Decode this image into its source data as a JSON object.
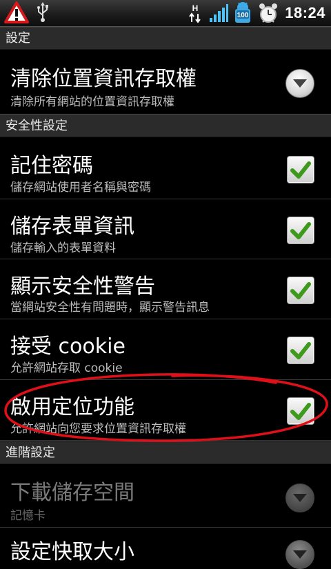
{
  "status_bar": {
    "time": "18:24",
    "network_label": "H",
    "battery_level": "100",
    "icons": [
      "warning-icon",
      "usb-icon",
      "hsdpa-icon",
      "signal-icon",
      "battery-icon",
      "alarm-clock-icon"
    ]
  },
  "sections": {
    "settings": "設定",
    "security": "安全性設定",
    "advanced": "進階設定"
  },
  "clear_location": {
    "title": "清除位置資訊存取權",
    "summary": "清除所有網站的位置資訊存取權"
  },
  "remember_passwords": {
    "title": "記住密碼",
    "summary": "儲存網站使用者名稱與密碼",
    "checked": true
  },
  "save_form_data": {
    "title": "儲存表單資訊",
    "summary": "儲存輸入的表單資料",
    "checked": true
  },
  "security_warnings": {
    "title": "顯示安全性警告",
    "summary": "當網站安全性有問題時，顯示警告訊息",
    "checked": true
  },
  "accept_cookies": {
    "title": "接受 cookie",
    "summary": "允許網站存取 cookie",
    "checked": true
  },
  "enable_location": {
    "title": "啟用定位功能",
    "summary": "允許網站向您要求位置資訊存取權",
    "checked": true
  },
  "download_storage": {
    "title": "下載儲存空間",
    "summary": "記憶卡"
  },
  "cache_size": {
    "title": "設定快取大小"
  },
  "colors": {
    "accent_check": "#3e9a1c",
    "annotation": "#e0101a",
    "section_bg": "#2b2b2b"
  }
}
